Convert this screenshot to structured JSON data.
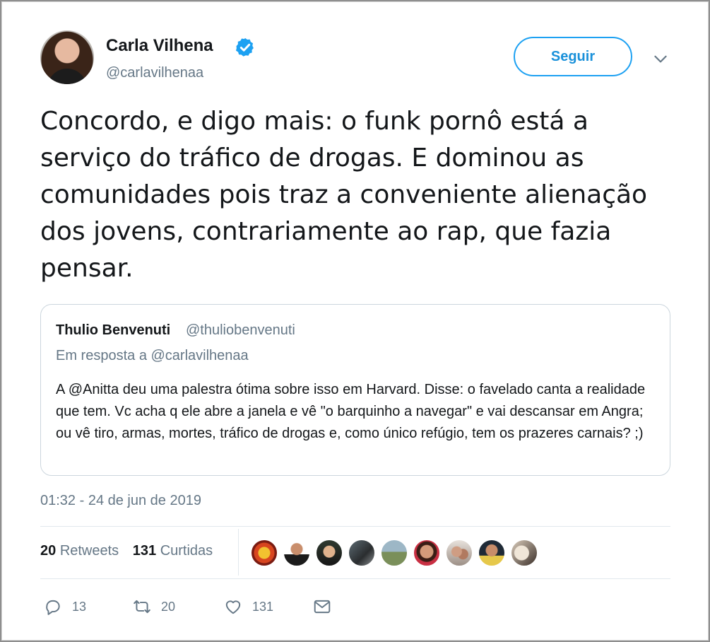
{
  "author": {
    "name": "Carla Vilhena",
    "handle": "@carlavilhenaa",
    "verified": true,
    "verified_icon": "verified-badge-icon"
  },
  "follow_label": "Seguir",
  "tweet_text": "Concordo, e digo mais: o funk pornô está a serviço do tráfico de drogas. E dominou as comunidades pois traz a conveniente alienação dos jovens, contrariamente ao rap, que fazia pensar.",
  "quoted": {
    "name": "Thulio Benvenuti",
    "handle": "@thuliobenvenuti",
    "reply_to": "Em resposta a @carlavilhenaa",
    "text": "A @Anitta deu uma palestra ótima sobre isso em Harvard. Disse: o favelado canta a realidade que tem. Vc acha q ele abre a janela e vê \"o barquinho a navegar\" e vai descansar em Angra; ou vê tiro, armas, mortes, tráfico de drogas e, como único refúgio, tem os prazeres carnais? ;)"
  },
  "timestamp": "01:32 - 24 de jun de 2019",
  "stats": {
    "retweets_count": "20",
    "retweets_label": "Retweets",
    "likes_count": "131",
    "likes_label": "Curtidas"
  },
  "actions": {
    "replies": "13",
    "retweets": "20",
    "likes": "131"
  },
  "colors": {
    "accent": "#1da1f2",
    "text": "#14171a",
    "muted": "#657786",
    "border": "#e1e8ed"
  }
}
